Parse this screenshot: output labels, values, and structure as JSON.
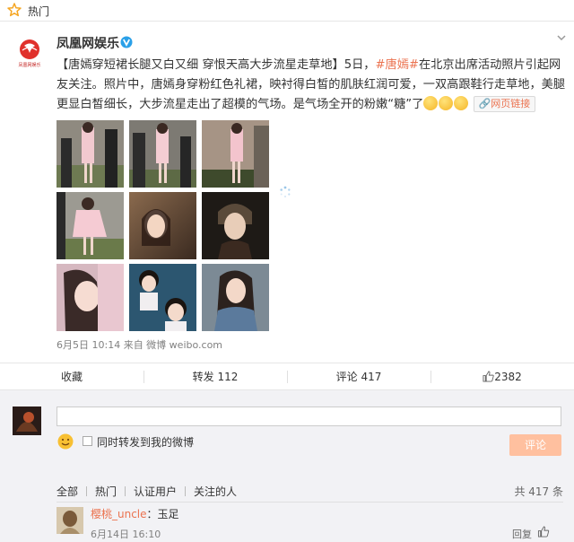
{
  "topbar": {
    "label": "热门"
  },
  "post": {
    "author": "凤凰网娱乐",
    "avatar_text": "凤凰网娱乐",
    "content": {
      "line1_prefix": "【唐嫣穿短裙长腿又白又细 穿恨天高大步流星走草地】5日，",
      "hashtag": "#唐嫣#",
      "line1_suffix": "在北京出席活动照片引起网友关注。照片中，唐嫣身穿粉红色礼裙，映衬得白皙的肌肤红润可爱，一双高跟鞋行走草地，美腿更显白皙细长，大步流星走出了超模的气场。是气场全开的粉嫩“糖”了",
      "weblink": "网页链接"
    },
    "meta": "6月5日 10:14 来自 微博 weibo.com"
  },
  "actions": {
    "favorite": "收藏",
    "repost": "转发 112",
    "comment": "评论 417",
    "like": "2382"
  },
  "comment_box": {
    "placeholder": "",
    "also_repost_label": "同时转发到我的微博",
    "submit_label": "评论"
  },
  "filters": [
    "全部",
    "热门",
    "认证用户",
    "关注的人"
  ],
  "total": "共 417 条",
  "comments": [
    {
      "user": "樱桃_uncle",
      "text": "：玉足",
      "time": "6月14日 16:10",
      "reply": "回复"
    }
  ],
  "colors": {
    "accent": "#eb7350",
    "button_disabled": "#ffc09f",
    "comment_bg": "#f2f2f5",
    "verified": "#2aa0e8"
  }
}
